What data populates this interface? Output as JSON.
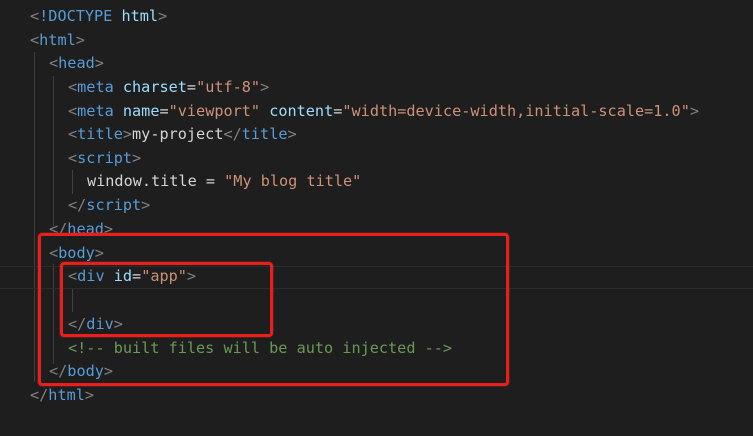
{
  "editor": {
    "background": "#1e1e1e",
    "colors": {
      "bracket": "#808080",
      "tag": "#569cd6",
      "attribute": "#9cdcfe",
      "string": "#ce9178",
      "text": "#d4d4d4",
      "comment": "#6a9955",
      "highlight_box": "#e8201d"
    },
    "lines": {
      "doctype": {
        "open": "<",
        "decl": "!DOCTYPE",
        "space": " ",
        "name": "html",
        "close": ">"
      },
      "html_open": {
        "open": "<",
        "tag": "html",
        "close": ">"
      },
      "head_open": {
        "open": "<",
        "tag": "head",
        "close": ">"
      },
      "meta_charset": {
        "open": "<",
        "tag": "meta",
        "attr": "charset",
        "eq": "=",
        "value": "\"utf-8\"",
        "close": ">"
      },
      "meta_viewport": {
        "open": "<",
        "tag": "meta",
        "attr1": "name",
        "eq1": "=",
        "value1": "\"viewport\"",
        "attr2": "content",
        "eq2": "=",
        "value2": "\"width=device-width,initial-scale=1.0\"",
        "close": ">"
      },
      "title": {
        "open": "<",
        "tag": "title",
        "close": ">",
        "text": "my-project",
        "end_open": "</",
        "end_tag": "title",
        "end_close": ">"
      },
      "script_open": {
        "open": "<",
        "tag": "script",
        "close": ">"
      },
      "script_body": {
        "code": "window.title = ",
        "string": "\"My blog title\""
      },
      "script_close": {
        "open": "</",
        "tag": "script",
        "close": ">"
      },
      "head_close": {
        "open": "</",
        "tag": "head",
        "close": ">"
      },
      "body_open": {
        "open": "<",
        "tag": "body",
        "close": ">"
      },
      "div_open": {
        "open": "<",
        "tag": "div",
        "attr": "id",
        "eq": "=",
        "value": "\"app\"",
        "close": ">"
      },
      "div_close": {
        "open": "</",
        "tag": "div",
        "close": ">"
      },
      "comment": {
        "text": "<!-- built files will be auto injected -->"
      },
      "body_close": {
        "open": "</",
        "tag": "body",
        "close": ">"
      },
      "html_close": {
        "open": "</",
        "tag": "html",
        "close": ">"
      }
    }
  }
}
